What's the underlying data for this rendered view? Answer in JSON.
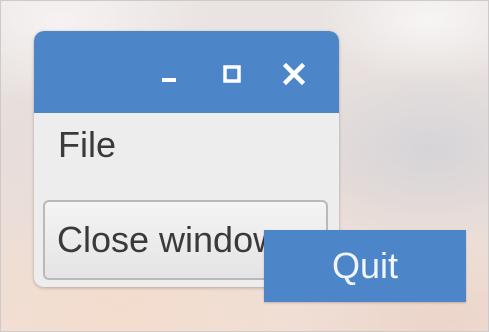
{
  "window": {
    "menubar": {
      "file_label": "File"
    },
    "button": {
      "label": "Close window"
    },
    "controls": {
      "minimize_icon": "minimize-icon",
      "maximize_icon": "maximize-icon",
      "close_icon": "close-icon"
    }
  },
  "popup_menu": {
    "items": [
      {
        "label": "Quit"
      }
    ]
  },
  "colors": {
    "titlebar": "#4c86c8",
    "menu_highlight": "#4c86c8",
    "window_bg": "#ededed",
    "text": "#3a3a3a"
  }
}
